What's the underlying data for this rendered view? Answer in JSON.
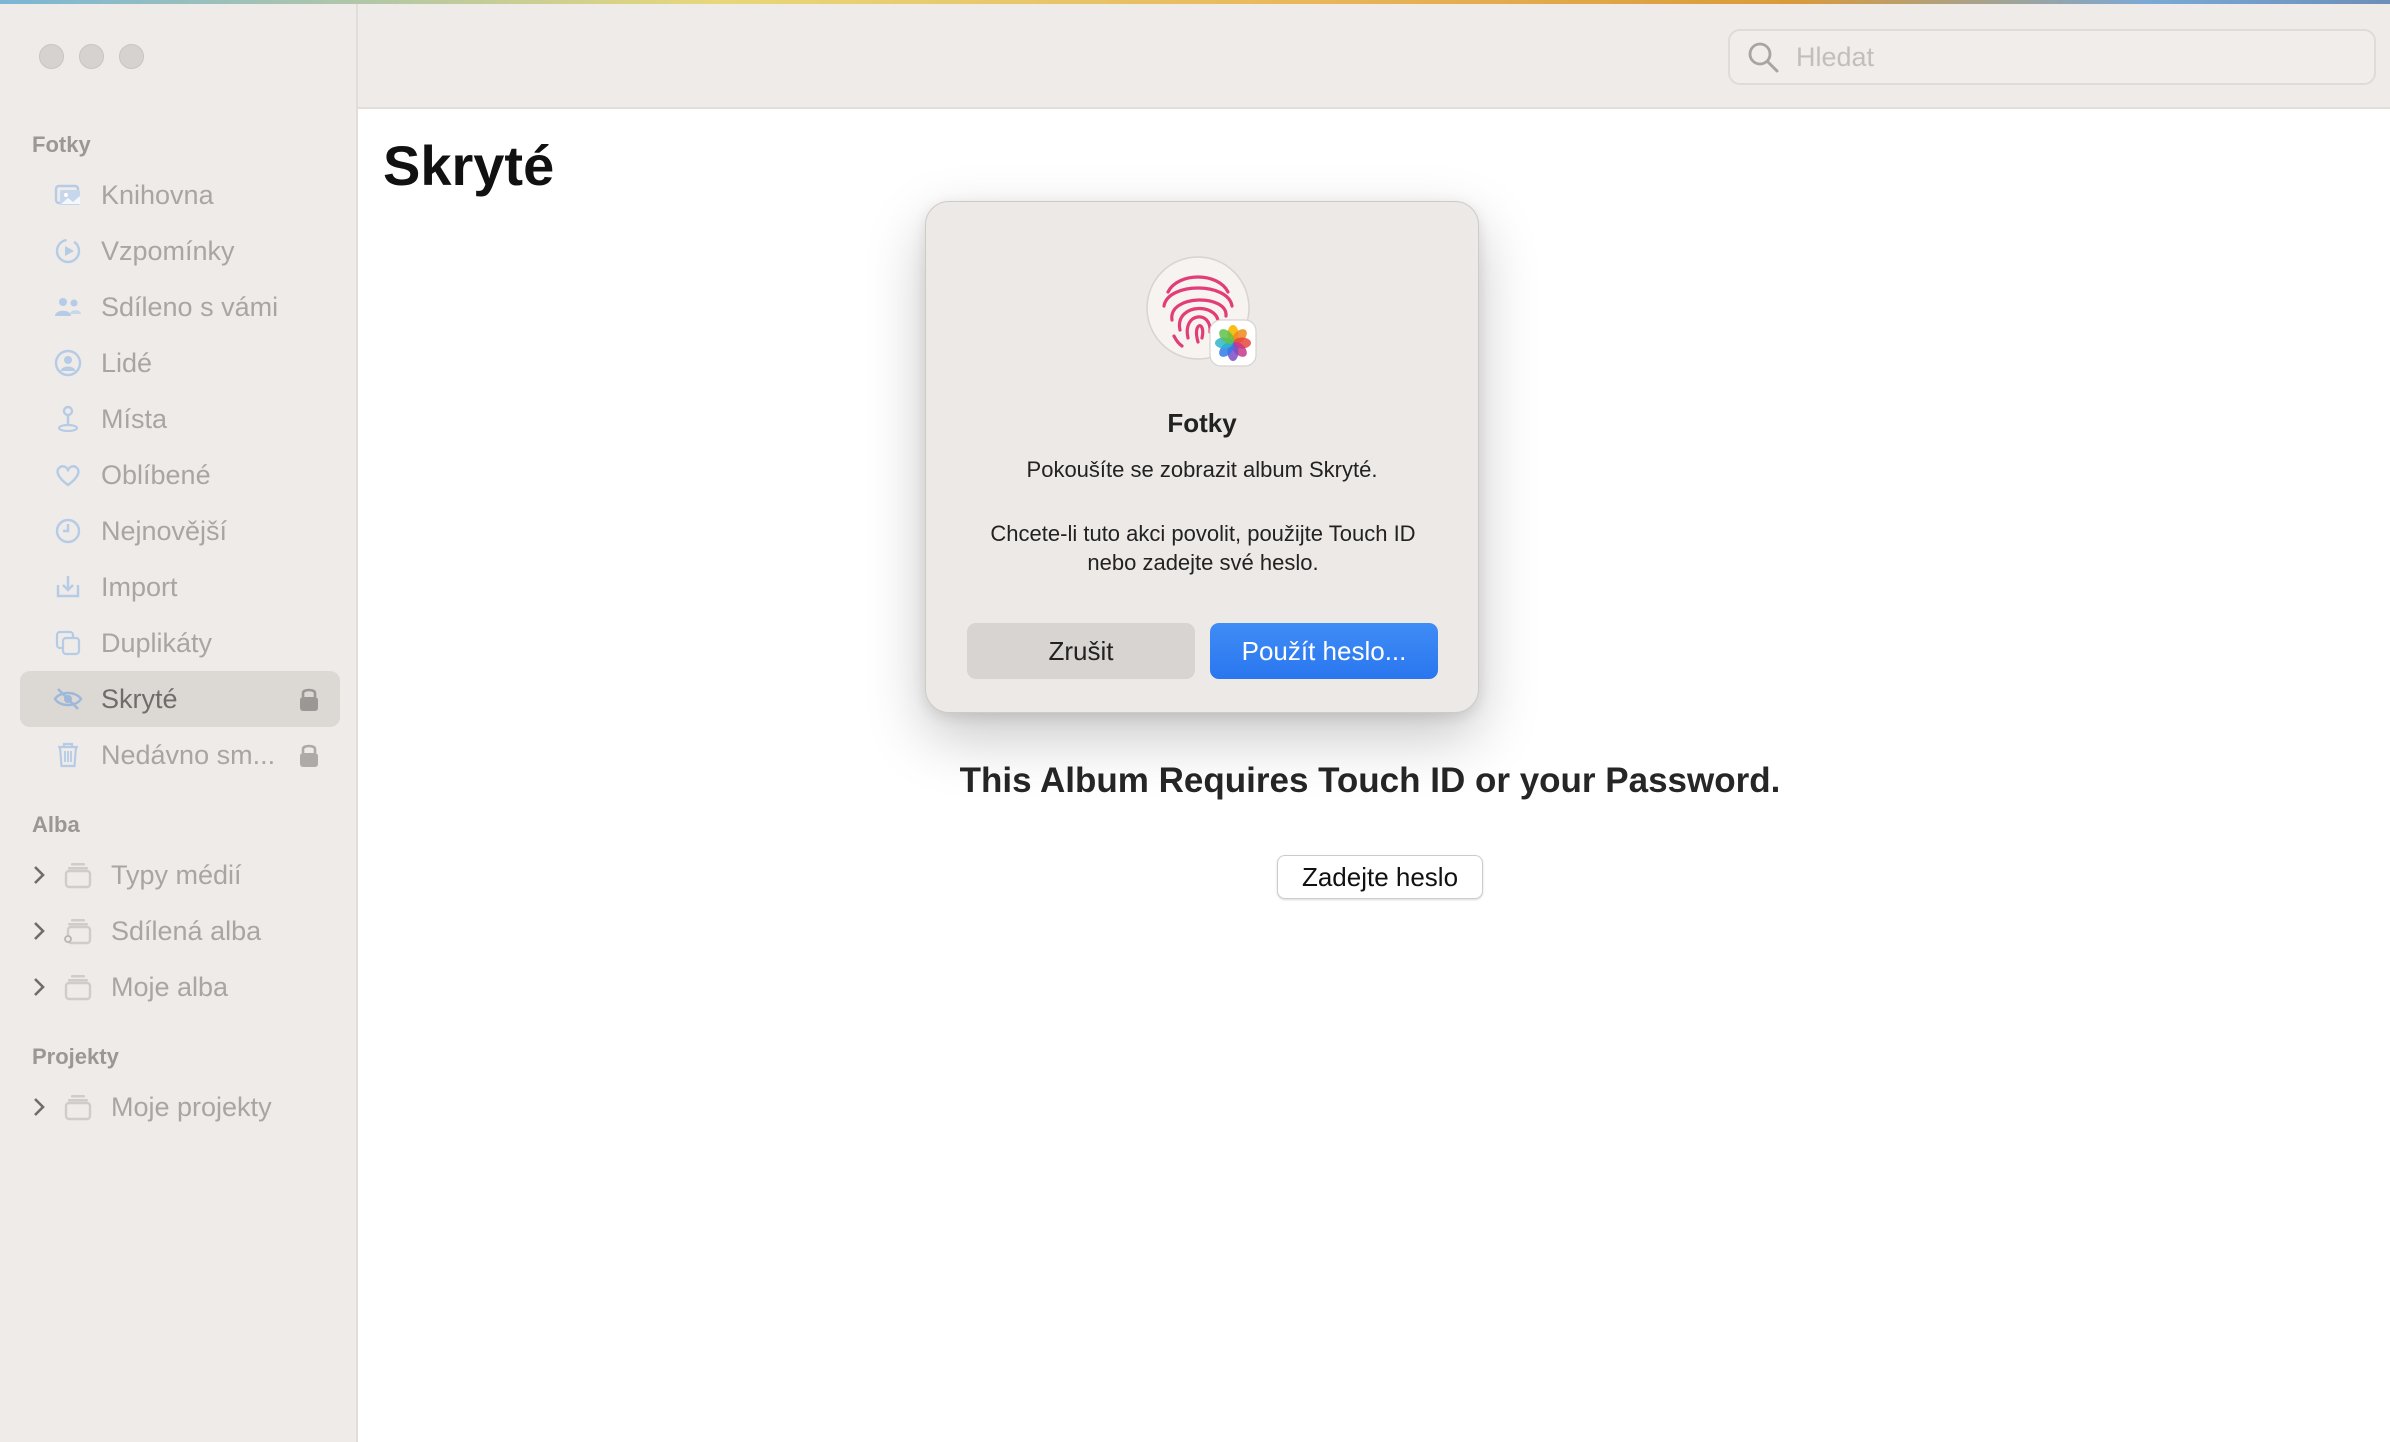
{
  "sidebar": {
    "sections": {
      "photos": "Fotky",
      "albums": "Alba",
      "projects": "Projekty"
    },
    "items": [
      {
        "label": "Knihovna",
        "icon": "library-icon"
      },
      {
        "label": "Vzpomínky",
        "icon": "memories-icon"
      },
      {
        "label": "Sdíleno s vámi",
        "icon": "shared-with-you-icon"
      },
      {
        "label": "Lidé",
        "icon": "people-icon"
      },
      {
        "label": "Místa",
        "icon": "places-icon"
      },
      {
        "label": "Oblíbené",
        "icon": "heart-icon"
      },
      {
        "label": "Nejnovější",
        "icon": "clock-icon"
      },
      {
        "label": "Import",
        "icon": "import-icon"
      },
      {
        "label": "Duplikáty",
        "icon": "duplicates-icon"
      },
      {
        "label": "Skryté",
        "icon": "eye-slash-icon",
        "selected": true,
        "locked": true
      },
      {
        "label": "Nedávno sm...",
        "icon": "trash-icon",
        "locked": true
      }
    ],
    "albums": [
      {
        "label": "Typy médií"
      },
      {
        "label": "Sdílená alba"
      },
      {
        "label": "Moje alba"
      }
    ],
    "projects": [
      {
        "label": "Moje projekty"
      }
    ]
  },
  "search": {
    "placeholder": "Hledat"
  },
  "main": {
    "title": "Skryté",
    "message": "This Album Requires Touch ID or your Password.",
    "enter_password_label": "Zadejte heslo"
  },
  "dialog": {
    "title": "Fotky",
    "message": "Pokoušíte se zobrazit album Skryté.",
    "info_line1": "Chcete-li tuto akci povolit, použijte Touch ID",
    "info_line2": "nebo zadejte své heslo.",
    "cancel_label": "Zrušit",
    "use_password_label": "Použít heslo..."
  },
  "colors": {
    "accent": "#2f7cf0",
    "sidebar_bg": "#efebe8",
    "icon_tint": "#b5cbe6",
    "fingerprint": "#e23d77"
  }
}
